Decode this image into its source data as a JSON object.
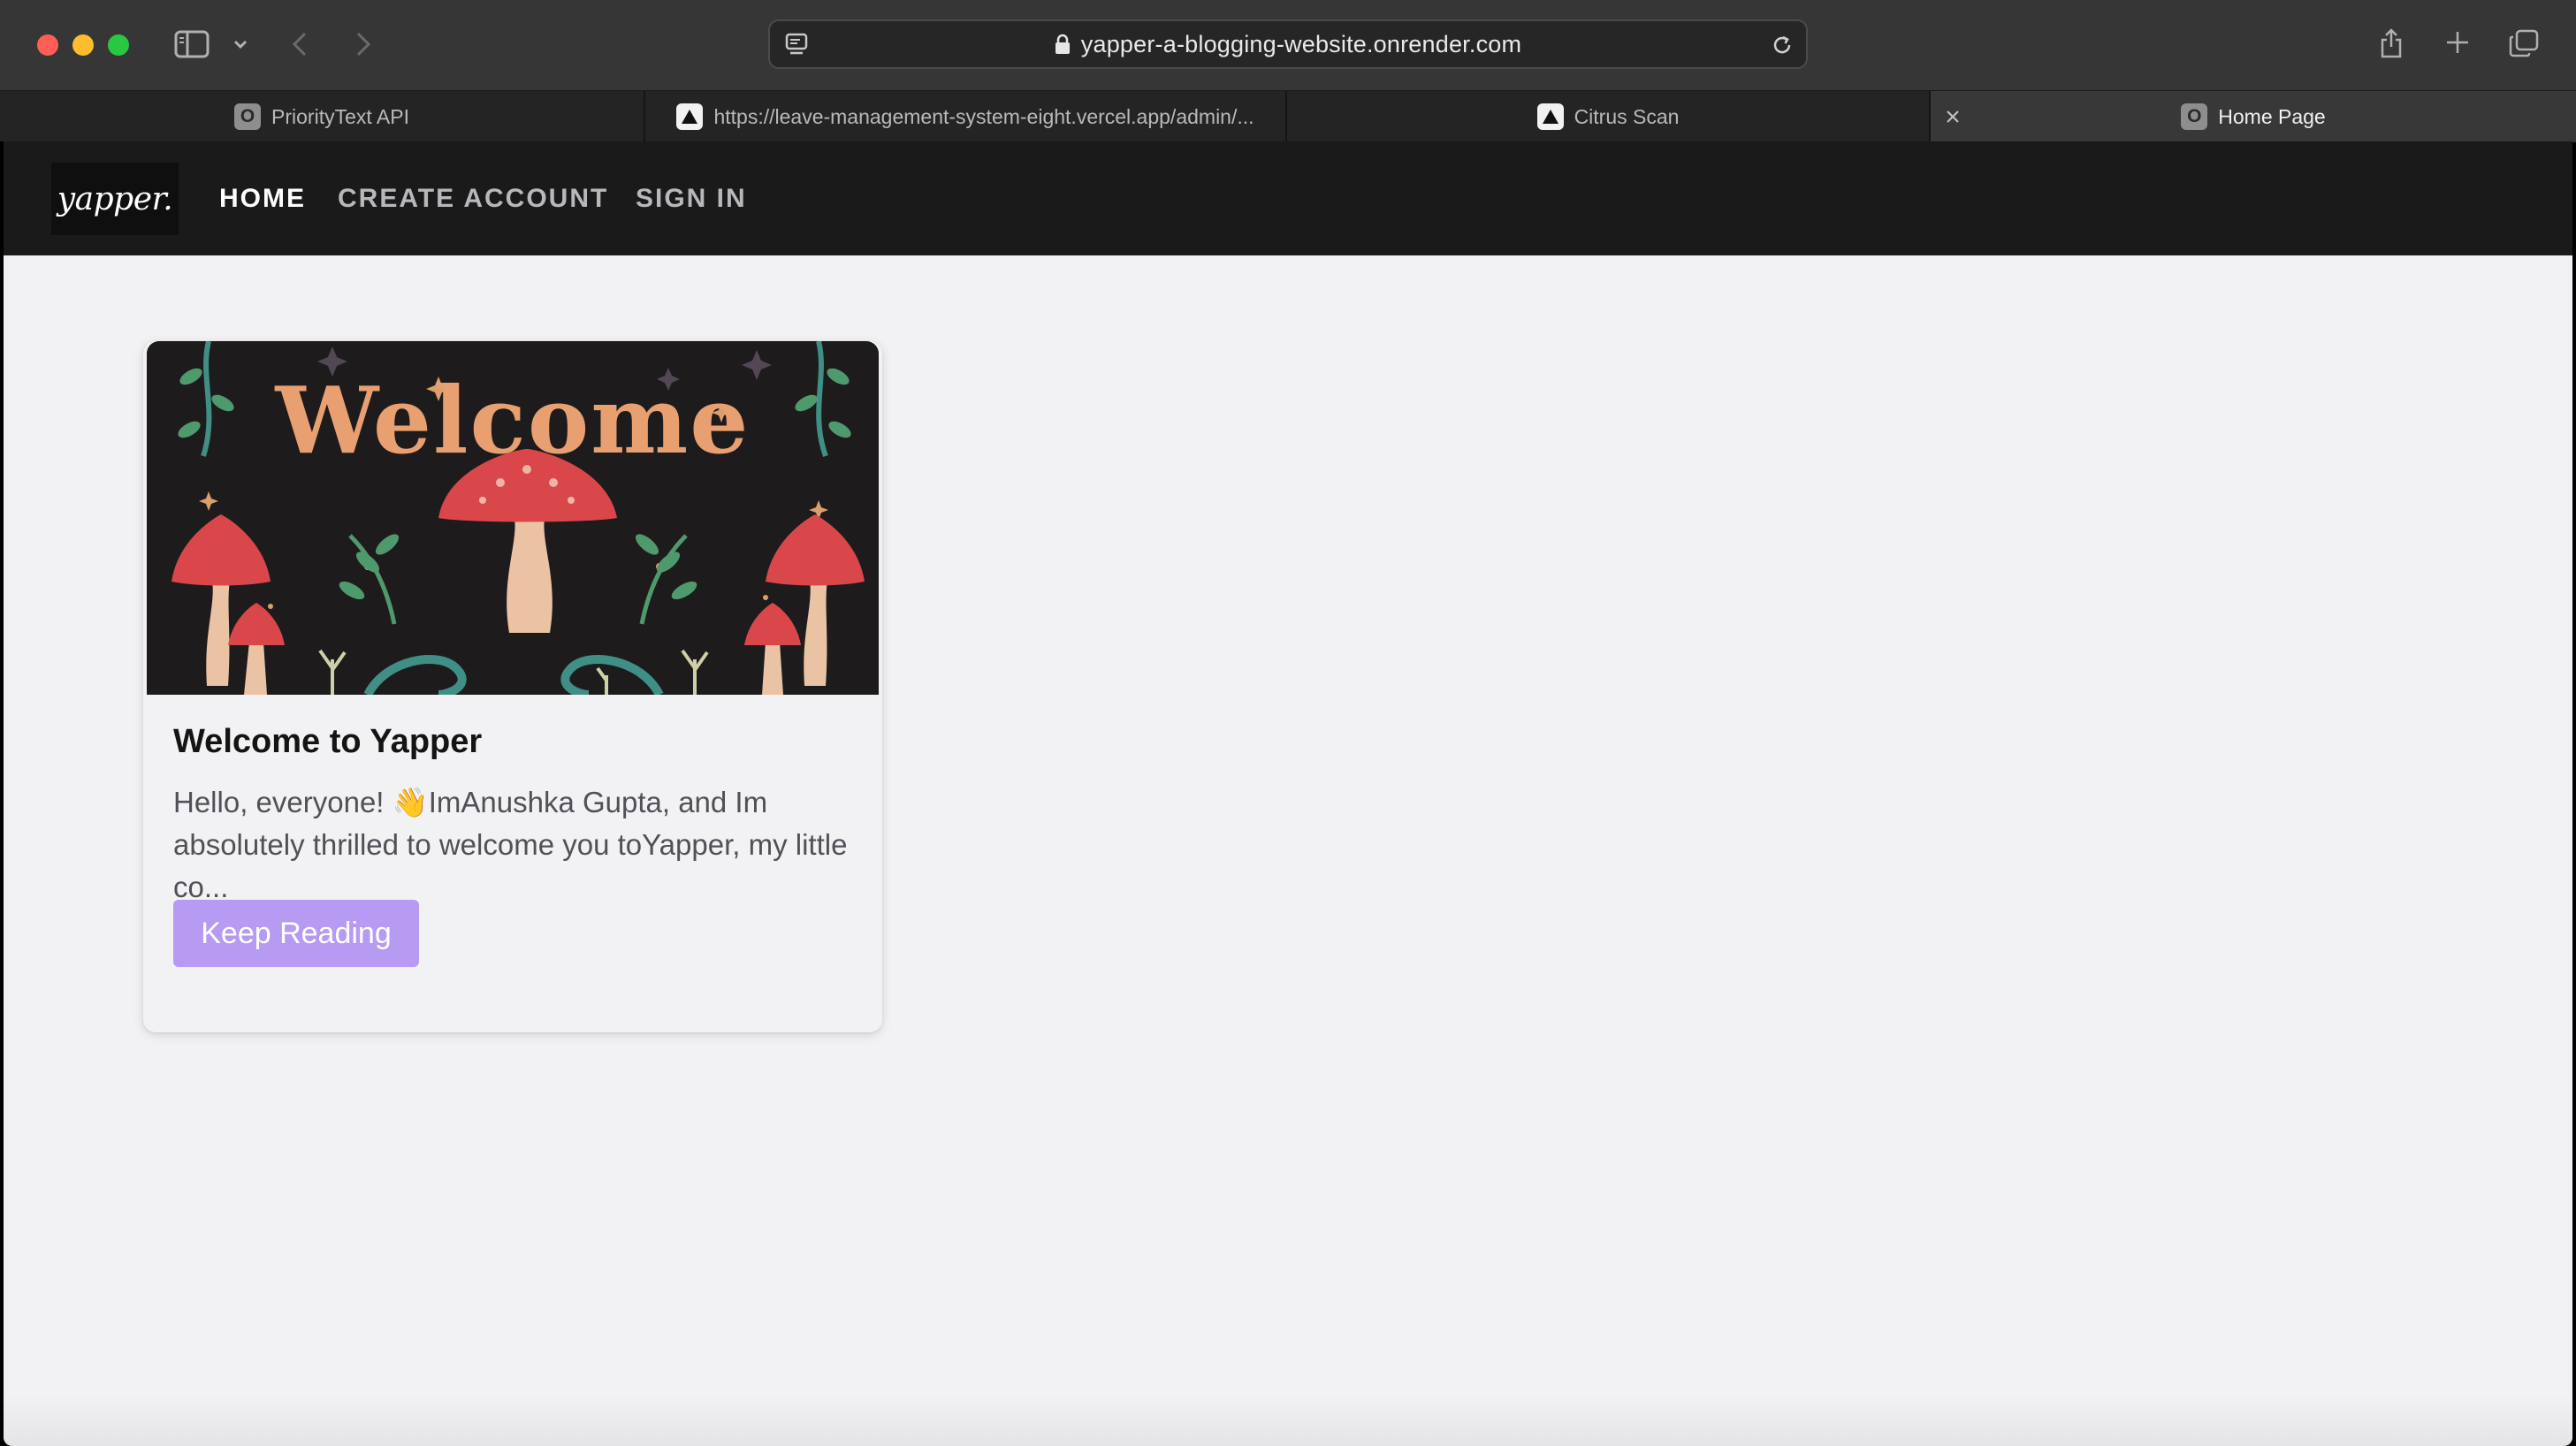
{
  "browser": {
    "url": "yapper-a-blogging-website.onrender.com",
    "tabs": [
      {
        "label": "PriorityText API",
        "favicon": "o-favicon",
        "active": false
      },
      {
        "label": "https://leave-management-system-eight.vercel.app/admin/...",
        "favicon": "vercel-favicon",
        "active": false
      },
      {
        "label": "Citrus Scan",
        "favicon": "vercel-favicon",
        "active": false
      },
      {
        "label": "Home Page",
        "favicon": "o-favicon",
        "active": true
      }
    ],
    "favicon_letter": "O"
  },
  "site": {
    "logo": "yapper.",
    "nav": {
      "home": "HOME",
      "create_account": "CREATE ACCOUNT",
      "sign_in": "SIGN IN"
    }
  },
  "posts": [
    {
      "title": "Welcome to Yapper",
      "excerpt": "Hello, everyone! 👋ImAnushka Gupta, and Im absolutely thrilled to welcome you toYapper, my little co...",
      "cta": "Keep Reading",
      "image_text": "Welcome"
    }
  ],
  "colors": {
    "chrome_bg": "#363636",
    "tab_bar_bg": "#242424",
    "navbar_bg": "#1a1a1a",
    "page_bg": "#f2f2f4",
    "button_bg": "#b79af2",
    "mat_bg": "#1d1b1c"
  }
}
